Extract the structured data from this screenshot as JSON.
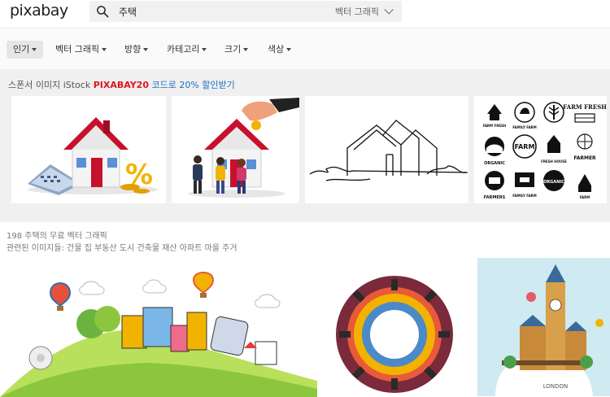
{
  "header": {
    "logo": "pixabay",
    "search_query": "주택",
    "media_type": "벡터 그래픽"
  },
  "filters": {
    "items": [
      {
        "label": "인기",
        "active": true,
        "dropdown": true
      },
      {
        "label": "벡터 그래픽",
        "active": false,
        "dropdown": true
      },
      {
        "label": "방향",
        "active": false,
        "dropdown": true
      },
      {
        "label": "카테고리",
        "active": false,
        "dropdown": true
      },
      {
        "label": "크기",
        "active": false,
        "dropdown": true
      },
      {
        "label": "색상",
        "active": false,
        "dropdown": true
      }
    ]
  },
  "sponsor": {
    "prefix": "스폰서 이미지 iStock",
    "code": "PIXABAY20",
    "suffix": "코드로 20% 할인받기"
  },
  "logo_grid_text": {
    "farm_fresh": "FARM FRESH",
    "family_farm": "FAMILY FARM",
    "farm": "FARM",
    "organic": "ORGANIC",
    "fresh_house": "FRESH HOUSE",
    "farmer": "FARMER",
    "farmers": "FARMERS"
  },
  "results": {
    "count_text": "198 주택의 무료 벡터 그래픽",
    "related_text": "관련된 이미지들: 건물 집 부동산 도시 건축물 재산 아파트 마을 주거"
  },
  "london_caption": "LONDON",
  "colors": {
    "accent_red": "#e0141e",
    "link_blue": "#1a6fc4",
    "sponsor_bg": "#f0f0f0",
    "filter_bg": "#fafafa"
  }
}
